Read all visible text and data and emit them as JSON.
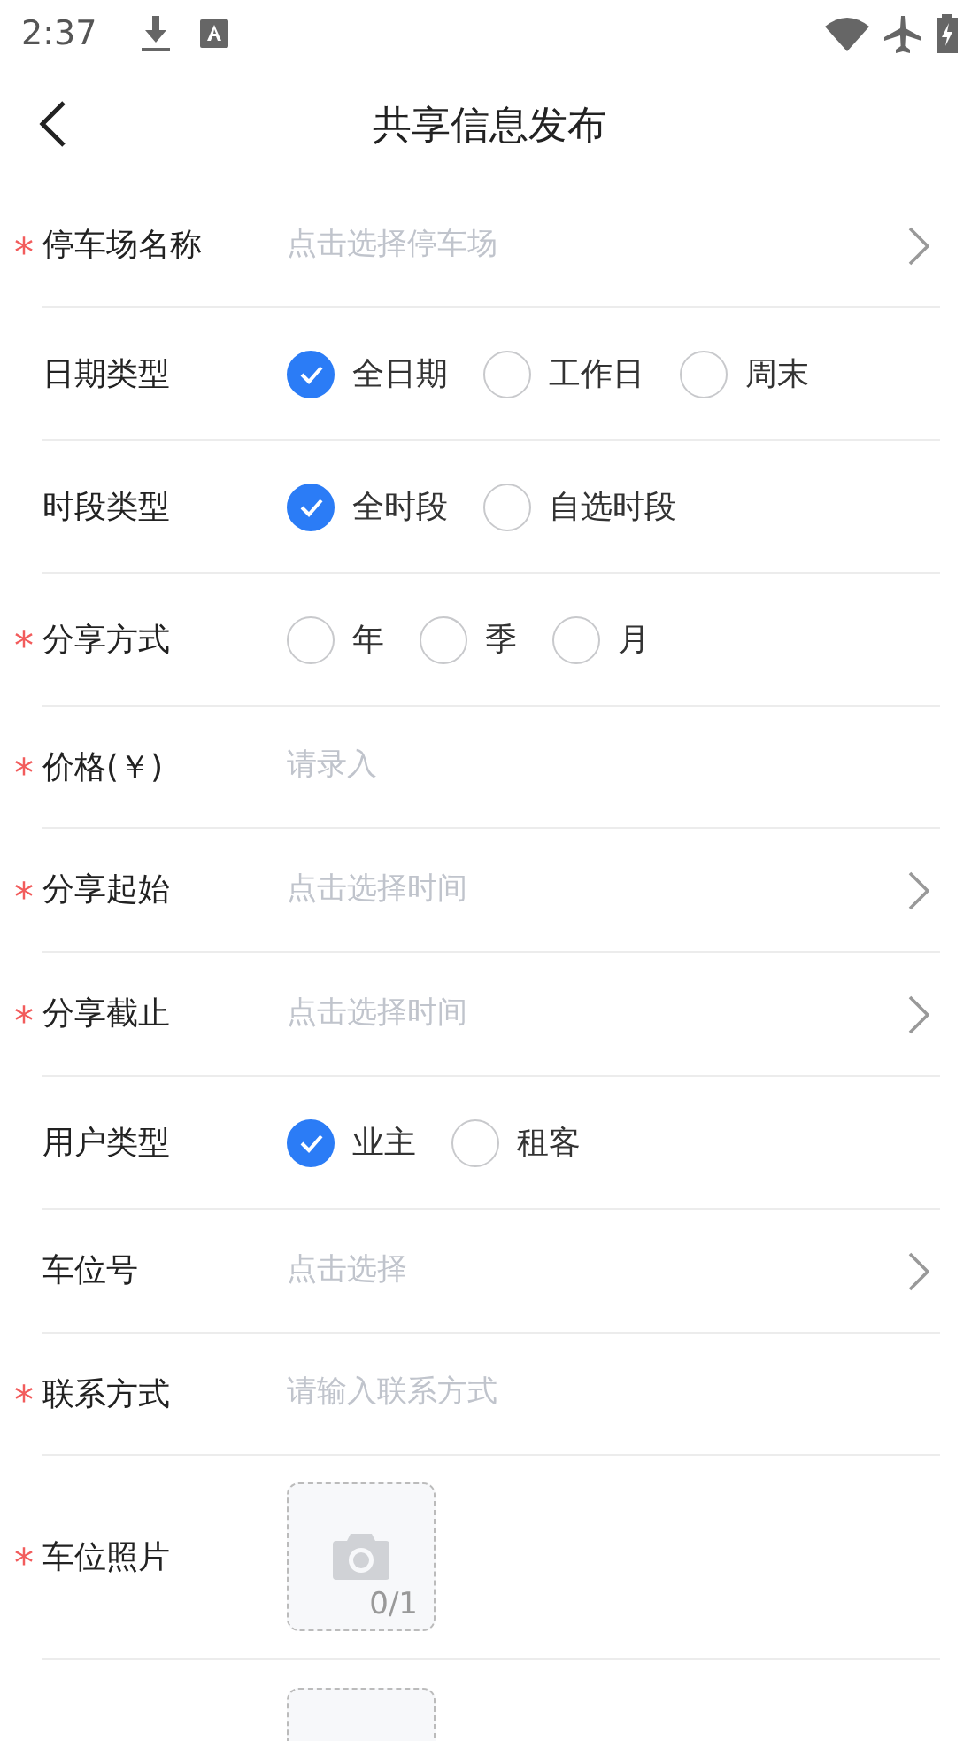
{
  "status_bar": {
    "time": "2:37"
  },
  "header": {
    "title": "共享信息发布"
  },
  "fields": [
    {
      "kind": "select",
      "mark": "*",
      "label": "停车场名称",
      "placeholder": "点击选择停车场"
    },
    {
      "kind": "radio",
      "label": "日期类型",
      "options": [
        {
          "label": "全日期",
          "selected": true
        },
        {
          "label": "工作日",
          "selected": false
        },
        {
          "label": "周末",
          "selected": false
        }
      ]
    },
    {
      "kind": "radio",
      "label": "时段类型",
      "options": [
        {
          "label": "全时段",
          "selected": true
        },
        {
          "label": "自选时段",
          "selected": false
        }
      ]
    },
    {
      "kind": "radio",
      "mark": "*",
      "label": "分享方式",
      "options": [
        {
          "label": "年",
          "selected": false
        },
        {
          "label": "季",
          "selected": false
        },
        {
          "label": "月",
          "selected": false
        }
      ]
    },
    {
      "kind": "input",
      "mark": "*",
      "label": "价格(￥)",
      "placeholder": "请录入"
    },
    {
      "kind": "select",
      "mark": "*",
      "label": "分享起始",
      "placeholder": "点击选择时间"
    },
    {
      "kind": "select",
      "mark": "*",
      "label": "分享截止",
      "placeholder": "点击选择时间"
    },
    {
      "kind": "radio",
      "label": "用户类型",
      "options": [
        {
          "label": "业主",
          "selected": true
        },
        {
          "label": "租客",
          "selected": false
        }
      ]
    },
    {
      "kind": "select",
      "label": "车位号",
      "placeholder": "点击选择"
    },
    {
      "kind": "input",
      "mark": "*",
      "label": "联系方式",
      "placeholder": "请输入联系方式"
    },
    {
      "kind": "upload",
      "mark": "*",
      "label": "车位照片",
      "count": "0/1"
    },
    {
      "kind": "upload"
    }
  ]
}
